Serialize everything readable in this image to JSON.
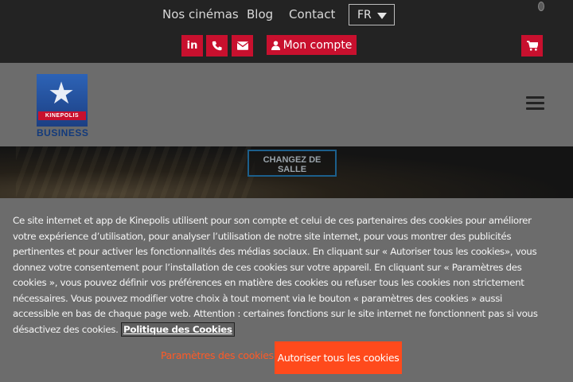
{
  "topnav": {
    "links": [
      "Nos cinémas",
      "Blog",
      "Contact"
    ],
    "language": "FR"
  },
  "social": {
    "linkedin_icon": "linkedin-icon",
    "phone_icon": "phone-icon",
    "email_icon": "envelope-icon"
  },
  "account": {
    "label": "Mon compte",
    "icon": "user-icon"
  },
  "cart": {
    "icon": "cart-icon"
  },
  "logo": {
    "ribbon": "KINEPOLIS",
    "subtitle": "BUSINESS"
  },
  "hero": {
    "change_room_label": "CHANGEZ DE SALLE"
  },
  "cookie": {
    "text": "Ce site internet et app de Kinepolis utilisent pour son compte et celui de ces partenaires des cookies pour améliorer votre expérience d’utilisation, pour analyser l’utilisation de notre site internet, pour vous montrer des publicités pertinentes et pour activer les fonctionnalités des médias sociaux. En cliquant sur « Autoriser tous les cookies», vous donnez votre consentement pour l’installation de ces cookies sur votre appareil. En cliquant sur « Paramètres des cookies », vous pouvez définir vos préférences en matière des cookies ou refuser tous les cookies non strictement nécessaires. Vous pouvez modifier votre choix à tout moment via le bouton « paramètres des cookies » aussi accessible en bas de chaque page web. Attention : certaines fonctions sur le site internet ne fonctionnent pas si vous désactivez des cookies.",
    "policy_link": "Politique des Cookies",
    "settings_label": "Paramètres des cookies",
    "accept_label": "Autoriser tous les cookies"
  },
  "colors": {
    "brand_red": "#c8102e",
    "accept_orange": "#ff4a1c",
    "settings_text": "#ff5a26"
  }
}
